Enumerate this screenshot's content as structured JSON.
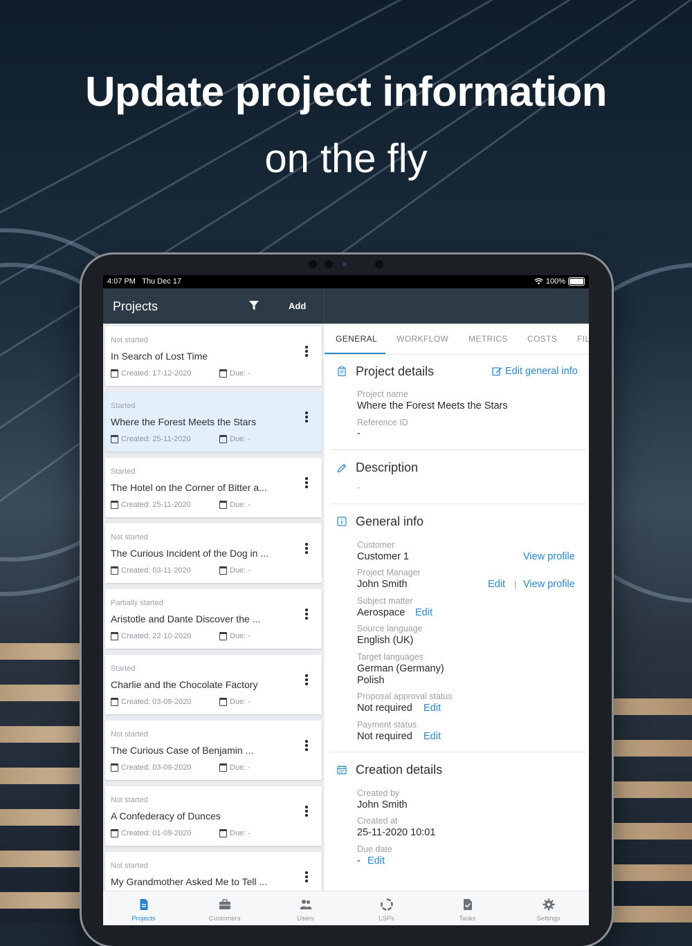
{
  "promo": {
    "headline": "Update project information",
    "subline": "on the fly"
  },
  "status_bar": {
    "time": "4:07 PM",
    "date": "Thu Dec 17",
    "battery": "100%"
  },
  "header": {
    "title": "Projects",
    "add_label": "Add"
  },
  "projects": [
    {
      "status": "Not started",
      "name": "In Search of Lost Time",
      "created": "Created: 17-12-2020",
      "due": "Due: -"
    },
    {
      "status": "Started",
      "name": "Where the Forest Meets the Stars",
      "created": "Created: 25-11-2020",
      "due": "Due: -"
    },
    {
      "status": "Started",
      "name": "The Hotel on the Corner of Bitter a...",
      "created": "Created: 25-11-2020",
      "due": "Due: -"
    },
    {
      "status": "Not started",
      "name": "The Curious Incident of the Dog in ...",
      "created": "Created: 03-11-2020",
      "due": "Due: -"
    },
    {
      "status": "Partially started",
      "name": "Aristotle and Dante Discover the ...",
      "created": "Created: 22-10-2020",
      "due": "Due: -"
    },
    {
      "status": "Started",
      "name": "Charlie and the Chocolate Factory",
      "created": "Created: 03-09-2020",
      "due": "Due: -"
    },
    {
      "status": "Not started",
      "name": "The Curious Case of Benjamin ...",
      "created": "Created: 03-09-2020",
      "due": "Due: -"
    },
    {
      "status": "Not started",
      "name": "A Confederacy of Dunces",
      "created": "Created: 01-09-2020",
      "due": "Due: -"
    },
    {
      "status": "Not started",
      "name": "My Grandmother Asked Me to Tell ...",
      "created": "",
      "due": ""
    }
  ],
  "tabs": [
    "GENERAL",
    "WORKFLOW",
    "METRICS",
    "COSTS",
    "FIL"
  ],
  "project_details": {
    "title": "Project details",
    "edit_link": "Edit general info",
    "project_name_label": "Project name",
    "project_name": "Where the Forest Meets the Stars",
    "reference_label": "Reference ID",
    "reference": "-"
  },
  "description": {
    "title": "Description",
    "value": "-"
  },
  "general_info": {
    "title": "General info",
    "customer_label": "Customer",
    "customer": "Customer 1",
    "view_profile": "View profile",
    "pm_label": "Project Manager",
    "pm": "John Smith",
    "edit": "Edit",
    "separator": "|",
    "subject_label": "Subject matter",
    "subject": "Aerospace",
    "source_label": "Source language",
    "source": "English (UK)",
    "target_label": "Target languages",
    "target_1": "German (Germany)",
    "target_2": "Polish",
    "proposal_label": "Proposal approval status",
    "proposal": "Not required",
    "payment_label": "Payment status",
    "payment": "Not required"
  },
  "creation": {
    "title": "Creation details",
    "created_by_label": "Created by",
    "created_by": "John Smith",
    "created_at_label": "Created at",
    "created_at": "25-11-2020 10:01",
    "due_label": "Due date",
    "due": "-",
    "edit": "Edit"
  },
  "bottom_nav": [
    "Projects",
    "Customers",
    "Users",
    "LSPs",
    "Tasks",
    "Settings"
  ],
  "colors": {
    "accent": "#2a86c8",
    "header_bg": "#2e3a46",
    "selected_card": "#e3f0fb"
  }
}
